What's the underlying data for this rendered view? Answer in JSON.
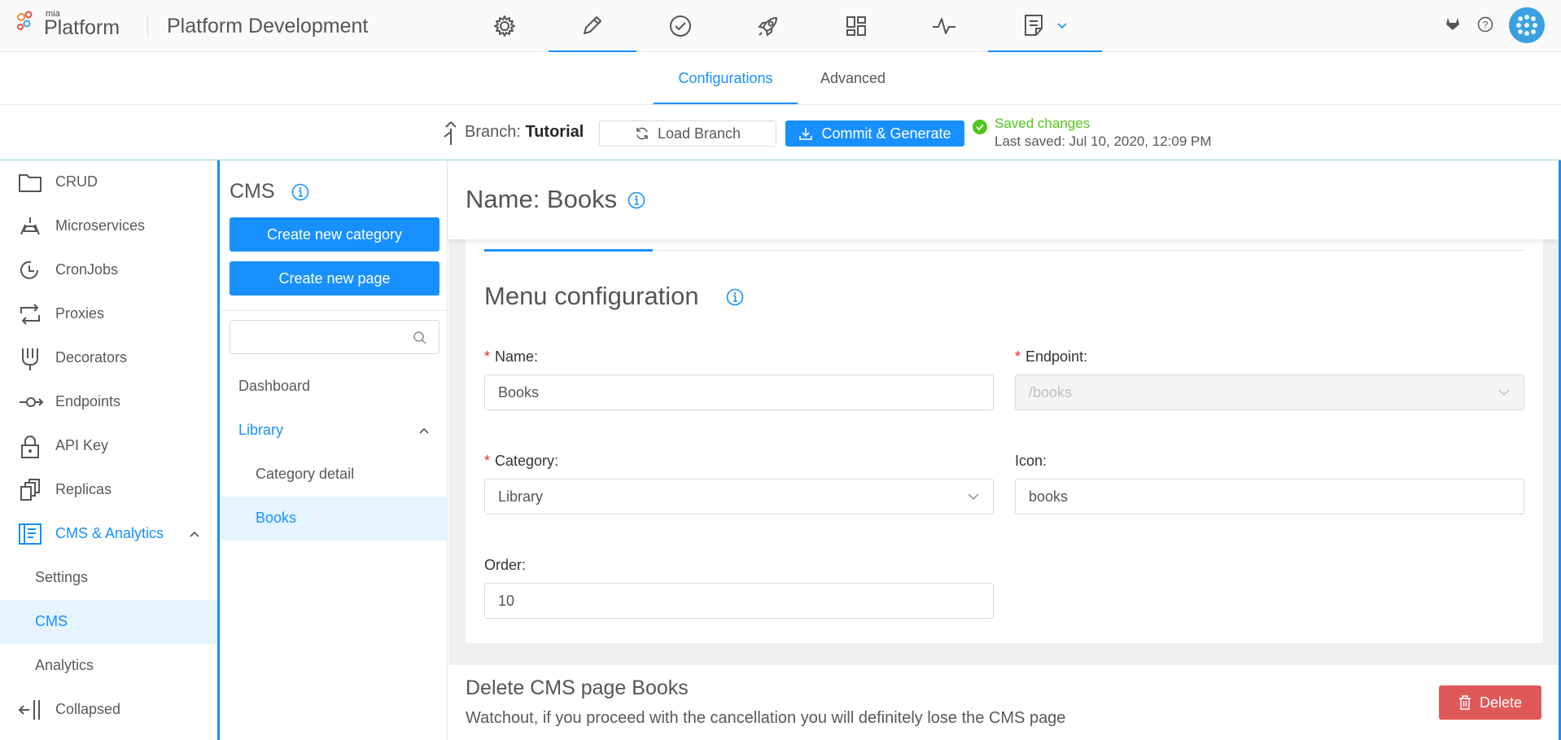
{
  "app": {
    "logo_small": "mia",
    "logo_text": "Platform",
    "project_title": "Platform Development"
  },
  "topnav": {
    "icons": [
      "gear-icon",
      "pencil-icon",
      "check-circle-icon",
      "rocket-icon",
      "dashboard-icon",
      "pulse-icon",
      "document-icon"
    ],
    "active": "pencil-icon"
  },
  "subtabs": {
    "configurations": "Configurations",
    "advanced": "Advanced",
    "active": "Configurations"
  },
  "branchbar": {
    "branch_prefix": "Branch: ",
    "branch_name": "Tutorial",
    "load_branch": "Load Branch",
    "commit_generate": "Commit & Generate",
    "saved_status": "Saved changes",
    "last_saved": "Last saved:  Jul 10, 2020, 12:09 PM"
  },
  "sidebar": {
    "items": [
      {
        "label": "CRUD",
        "icon": "folder-icon"
      },
      {
        "label": "Microservices",
        "icon": "microservices-icon"
      },
      {
        "label": "CronJobs",
        "icon": "clock-icon"
      },
      {
        "label": "Proxies",
        "icon": "swap-icon"
      },
      {
        "label": "Decorators",
        "icon": "fork-icon"
      },
      {
        "label": "Endpoints",
        "icon": "endpoint-icon"
      },
      {
        "label": "API Key",
        "icon": "lock-icon"
      },
      {
        "label": "Replicas",
        "icon": "copy-icon"
      },
      {
        "label": "CMS & Analytics",
        "icon": "cms-icon"
      },
      {
        "label": "Settings"
      },
      {
        "label": "CMS"
      },
      {
        "label": "Analytics"
      },
      {
        "label": "Collapsed",
        "icon": "collapse-icon"
      }
    ]
  },
  "cms": {
    "title": "CMS",
    "create_category": "Create new category",
    "create_page": "Create new page",
    "search_placeholder": "",
    "tree": {
      "dashboard": "Dashboard",
      "library": "Library",
      "category_detail": "Category detail",
      "books": "Books"
    }
  },
  "main": {
    "title": "Name: Books",
    "section_title": "Menu configuration",
    "form": {
      "name_label": "Name",
      "name_value": "Books",
      "endpoint_label": "Endpoint",
      "endpoint_value": "/books",
      "category_label": "Category",
      "category_value": "Library",
      "icon_label": "Icon",
      "icon_value": "books",
      "order_label": "Order",
      "order_value": "10"
    },
    "delete": {
      "title": "Delete CMS page Books",
      "description": "Watchout, if you proceed with the cancellation you will definitely lose the CMS page",
      "button": "Delete"
    }
  },
  "colors": {
    "primary": "#1890ff",
    "success": "#52c41a",
    "danger": "#e05858",
    "selected_bg": "#e6f4ff"
  }
}
